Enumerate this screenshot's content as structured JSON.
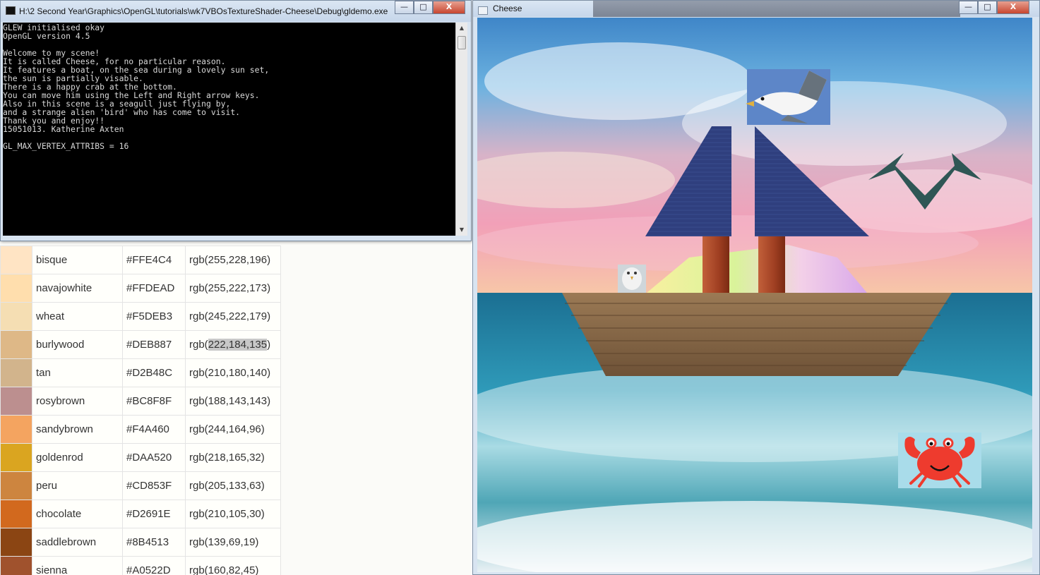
{
  "console_window": {
    "title": "H:\\2 Second Year\\Graphics\\OpenGL\\tutorials\\wk7VBOsTextureShader-Cheese\\Debug\\gldemo.exe",
    "minimize": "—",
    "maximize": "□",
    "close": "X",
    "output_lines": [
      "GLEW initialised okay",
      "OpenGL version 4.5",
      "",
      "Welcome to my scene!",
      "It is called Cheese, for no particular reason.",
      "It features a boat, on the sea during a lovely sun set,",
      "the sun is partially visable.",
      "There is a happy crab at the bottom.",
      "You can move him using the Left and Right arrow keys.",
      "Also in this scene is a seagull just flying by,",
      "and a strange alien 'bird' who has come to visit.",
      "Thank you and enjoy!!",
      "15051013. Katherine Axten",
      "",
      "GL_MAX_VERTEX_ATTRIBS = 16"
    ],
    "scroll_up": "▲",
    "scroll_down": "▼"
  },
  "cheese_window": {
    "title": "Cheese",
    "minimize": "—",
    "maximize": "□",
    "close": "X"
  },
  "color_table": {
    "rows": [
      {
        "name": "bisque",
        "hex": "#FFE4C4",
        "rgb": "rgb(255,228,196)",
        "swatch": "#FFE4C4"
      },
      {
        "name": "navajowhite",
        "hex": "#FFDEAD",
        "rgb": "rgb(255,222,173)",
        "swatch": "#FFDEAD"
      },
      {
        "name": "wheat",
        "hex": "#F5DEB3",
        "rgb": "rgb(245,222,179)",
        "swatch": "#F5DEB3"
      },
      {
        "name": "burlywood",
        "hex": "#DEB887",
        "rgb_prefix": "rgb(",
        "rgb_selected": "222,184,135",
        "rgb_suffix": ")",
        "swatch": "#DEB887"
      },
      {
        "name": "tan",
        "hex": "#D2B48C",
        "rgb": "rgb(210,180,140)",
        "swatch": "#D2B48C"
      },
      {
        "name": "rosybrown",
        "hex": "#BC8F8F",
        "rgb": "rgb(188,143,143)",
        "swatch": "#BC8F8F"
      },
      {
        "name": "sandybrown",
        "hex": "#F4A460",
        "rgb": "rgb(244,164,96)",
        "swatch": "#F4A460"
      },
      {
        "name": "goldenrod",
        "hex": "#DAA520",
        "rgb": "rgb(218,165,32)",
        "swatch": "#DAA520"
      },
      {
        "name": "peru",
        "hex": "#CD853F",
        "rgb": "rgb(205,133,63)",
        "swatch": "#CD853F"
      },
      {
        "name": "chocolate",
        "hex": "#D2691E",
        "rgb": "rgb(210,105,30)",
        "swatch": "#D2691E"
      },
      {
        "name": "saddlebrown",
        "hex": "#8B4513",
        "rgb": "rgb(139,69,19)",
        "swatch": "#8B4513"
      },
      {
        "name": "sienna",
        "hex": "#A0522D",
        "rgb": "rgb(160,82,45)",
        "swatch": "#A0522D"
      }
    ]
  },
  "scene_colors": {
    "sail": "#2f3f7e",
    "mast": "#a8442a",
    "hull": "#8a6a4a",
    "alien_bird": "#2f5655",
    "crab": "#ee3b2e",
    "crab_bg": "#a9dcea",
    "sea": "#2a8aa8"
  }
}
